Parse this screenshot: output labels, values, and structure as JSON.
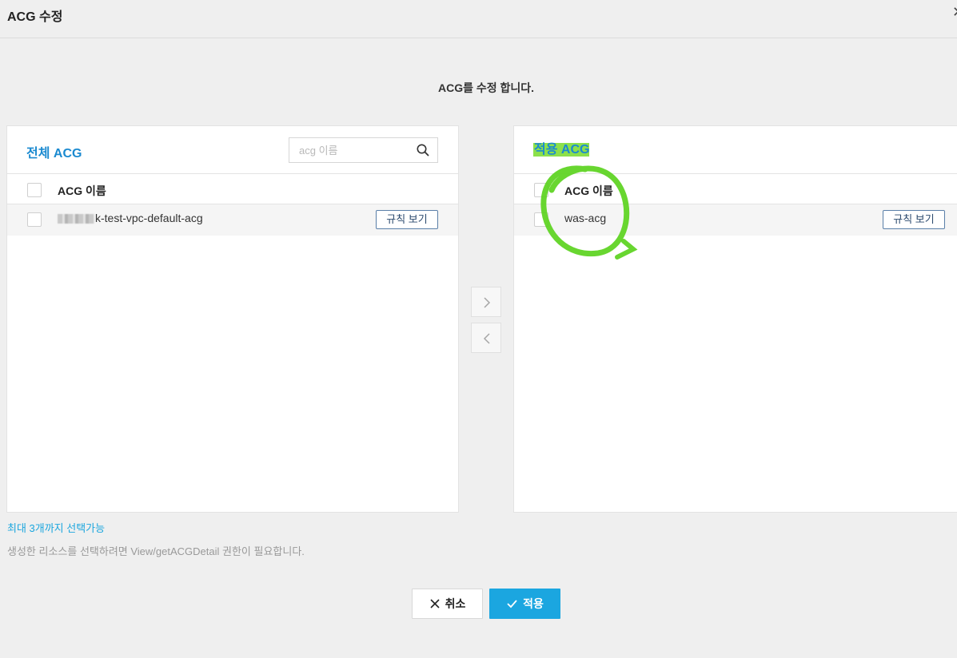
{
  "header": {
    "title": "ACG 수정",
    "close_icon": "close-icon"
  },
  "description": "ACG를 수정 합니다.",
  "left_panel": {
    "title": "전체 ACG",
    "search_placeholder": "acg 이름",
    "column_header": "ACG 이름",
    "rows": [
      {
        "name_suffix": "k-test-vpc-default-acg",
        "name_prefix_redacted": true,
        "rule_button": "규칙 보기"
      }
    ]
  },
  "right_panel": {
    "title": "적용 ACG",
    "column_header": "ACG 이름",
    "rows": [
      {
        "name": "was-acg",
        "rule_button": "규칙 보기"
      }
    ]
  },
  "notes": {
    "max_select": "최대 3개까지 선택가능",
    "permission": "생성한 리소스를 선택하려면 View/getACGDetail 권한이 필요합니다."
  },
  "buttons": {
    "cancel": "취소",
    "apply": "적용"
  },
  "colors": {
    "accent": "#1ba6e0",
    "title_blue": "#1b8ad0",
    "highlight_green": "#8ce04b",
    "annotation_green": "#5bd21e"
  }
}
